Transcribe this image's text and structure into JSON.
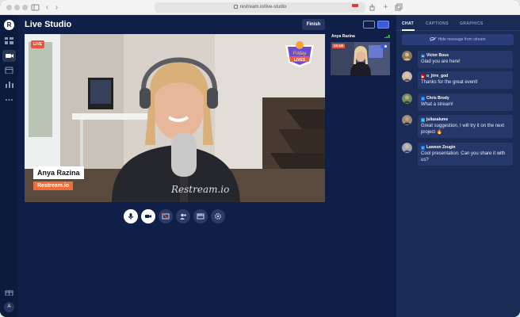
{
  "browser": {
    "url": "restream.io/live-studio"
  },
  "nav": {
    "logo_letter": "R",
    "items": [
      {
        "icon": "grid-icon"
      },
      {
        "icon": "video-camera-icon",
        "active": true
      },
      {
        "icon": "calendar-icon"
      },
      {
        "icon": "analytics-icon"
      },
      {
        "icon": "more-icon"
      }
    ],
    "bottom": [
      {
        "icon": "gift-icon"
      }
    ],
    "avatar_letter": "A"
  },
  "studio": {
    "title": "Live Studio",
    "finish_label": "Finish",
    "live_badge": "LIVE",
    "name_tag": "Anya Razina",
    "org_tag": "Restream.io",
    "sticker_text": "Friday LIVES",
    "guest": {
      "name": "Anya Razina",
      "badge": "ON AIR"
    },
    "controls": [
      {
        "icon": "microphone-icon",
        "active": true
      },
      {
        "icon": "video-camera-icon",
        "active": true
      },
      {
        "icon": "screen-share-icon",
        "active": false
      },
      {
        "icon": "invite-guest-icon",
        "active": false
      },
      {
        "icon": "film-icon",
        "active": false
      },
      {
        "icon": "settings-icon",
        "active": false
      }
    ]
  },
  "panel": {
    "tabs": [
      "CHAT",
      "CAPTIONS",
      "GRAPHICS"
    ],
    "active_tab": "CHAT",
    "hide_label": "Hide message from stream",
    "messages": [
      {
        "user": "Victor Bous",
        "platform": "linkedin",
        "platform_icon": "linkedin-icon",
        "text": "Glad you are here!",
        "color": "#0a66c2"
      },
      {
        "user": "o_jirre_god",
        "platform": "youtube",
        "platform_icon": "youtube-icon",
        "text": "Thanks for the great event!",
        "color": "#ff0000"
      },
      {
        "user": "Chris Brody",
        "platform": "facebook",
        "platform_icon": "facebook-icon",
        "text": "What a stream!",
        "color": "#1877f2"
      },
      {
        "user": "juliasalume",
        "platform": "twitter",
        "platform_icon": "twitter-icon",
        "text": "Great suggestion, I will try it on the next project 🔥",
        "color": "#1da1f2"
      },
      {
        "user": "Lawson Zeugin",
        "platform": "facebook",
        "platform_icon": "facebook-icon",
        "text": "Cool presentation. Can you share it with us?",
        "color": "#1877f2"
      }
    ]
  },
  "colors": {
    "background": "#0f1f47",
    "panel": "#1a2b55",
    "accent": "#3b5bd9",
    "live": "#f0533b"
  }
}
